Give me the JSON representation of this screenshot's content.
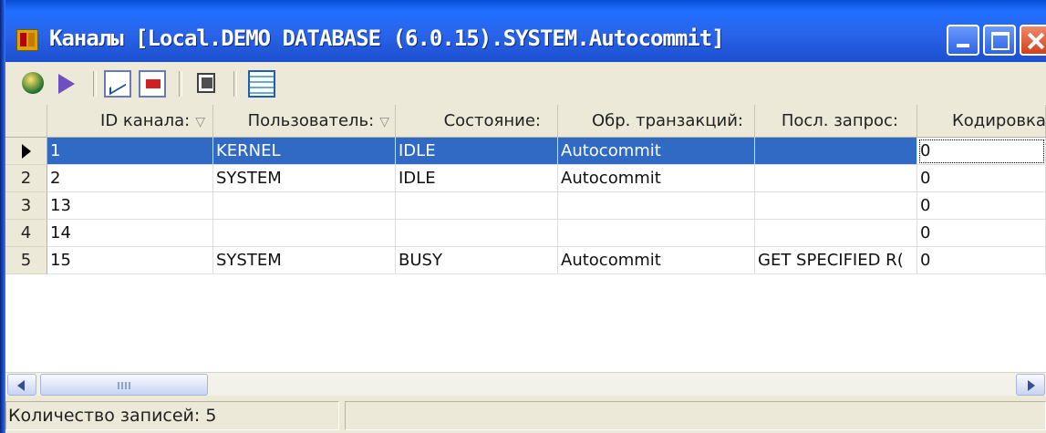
{
  "window": {
    "title": "Каналы [Local.DEMO DATABASE (6.0.15).SYSTEM.Autocommit]",
    "controls": [
      "minimize-icon",
      "maximize-icon",
      "close-icon"
    ]
  },
  "toolbar": {
    "icons": [
      "refresh-globe-icon",
      "run-arrow-icon",
      "chart-icon",
      "stop-icon",
      "properties-icon",
      "table-icon"
    ]
  },
  "table": {
    "columns": [
      {
        "label": "ID канала:",
        "sortable": true
      },
      {
        "label": "Пользователь:",
        "sortable": true
      },
      {
        "label": "Состояние:",
        "sortable": false
      },
      {
        "label": "Обр. транзакций:",
        "sortable": false
      },
      {
        "label": "Посл. запрос:",
        "sortable": false
      },
      {
        "label": "Кодировка",
        "sortable": false
      }
    ],
    "sort_glyph": "▽",
    "rows": [
      {
        "num": "",
        "current": true,
        "cells": [
          "1",
          "KERNEL",
          "IDLE",
          "Autocommit",
          "",
          "0"
        ]
      },
      {
        "num": "2",
        "cells": [
          "2",
          "SYSTEM",
          "IDLE",
          "Autocommit",
          "",
          "0"
        ]
      },
      {
        "num": "3",
        "cells": [
          "13",
          "",
          "",
          "",
          "",
          "0"
        ]
      },
      {
        "num": "4",
        "cells": [
          "14",
          "",
          "",
          "",
          "",
          "0"
        ]
      },
      {
        "num": "5",
        "cells": [
          "15",
          "SYSTEM",
          "BUSY",
          "Autocommit",
          "GET SPECIFIED R(",
          "0"
        ]
      }
    ]
  },
  "status": {
    "record_count": "Количество записей: 5",
    "right": ""
  },
  "colors": {
    "titlebar": "#1f5fe0",
    "selection": "#316ac5",
    "chrome": "#ece9d8"
  }
}
